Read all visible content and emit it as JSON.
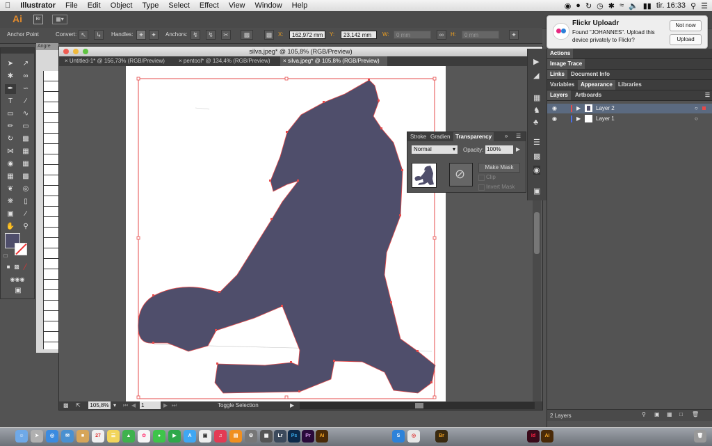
{
  "menubar": {
    "app_name": "Illustrator",
    "items": [
      "File",
      "Edit",
      "Object",
      "Type",
      "Select",
      "Effect",
      "View",
      "Window",
      "Help"
    ],
    "clock": "tir. 16:33"
  },
  "appbar": {
    "logo": "Ai",
    "bridge": "Br"
  },
  "control_bar": {
    "anchor_point": "Anchor Point",
    "convert": "Convert:",
    "handles": "Handles:",
    "anchors": "Anchors:",
    "x_label": "X:",
    "x_value": "162,972 mm",
    "y_label": "Y:",
    "y_value": "23,142 mm",
    "w_label": "W:",
    "w_value": "0 mm",
    "h_label": "H:",
    "h_value": "0 mm"
  },
  "notification": {
    "title": "Flickr Uploadr",
    "message_line1": "Found \"JOHANNES\". Upload this",
    "message_line2": "device privately to Flickr?",
    "not_now": "Not now",
    "upload": "Upload"
  },
  "document": {
    "window_title": "silva.jpeg* @ 105,8% (RGB/Preview)",
    "tabs": [
      {
        "label": "Untitled-1* @ 156,73% (RGB/Preview)"
      },
      {
        "label": "pentool* @ 134,4% (RGB/Preview)"
      },
      {
        "label": "silva.jpeg* @ 105,8% (RGB/Preview)"
      }
    ],
    "zoom": "105,8%",
    "artboard_number": "1",
    "status": "Toggle Selection",
    "background_window_label": "Angre"
  },
  "transparency_panel": {
    "tabs": [
      "Stroke",
      "Gradien",
      "Transparency"
    ],
    "blend_mode": "Normal",
    "opacity_label": "Opacity:",
    "opacity_value": "100%",
    "make_mask": "Make Mask",
    "clip": "Clip",
    "invert_mask": "Invert Mask"
  },
  "right_panel": {
    "actions": "Actions",
    "image_trace": "Image Trace",
    "links": "Links",
    "document_info": "Document Info",
    "variables": "Variables",
    "appearance": "Appearance",
    "libraries": "Libraries",
    "layers_tab": "Layers",
    "artboards_tab": "Artboards",
    "layers": [
      {
        "name": "Layer 2",
        "color": "#e64a4a",
        "selected": true
      },
      {
        "name": "Layer 1",
        "color": "#4a6ee6",
        "selected": false
      }
    ],
    "layers_count": "2 Layers"
  },
  "colors": {
    "shape_fill": "#4f4e6b",
    "selection": "#e64a4a",
    "ui_dark": "#535353",
    "layer_selected": "#5b6a80"
  },
  "dock_apps": [
    "Lr",
    "Ps",
    "Pr",
    "Ai",
    "Br",
    "Id",
    "Ai"
  ]
}
